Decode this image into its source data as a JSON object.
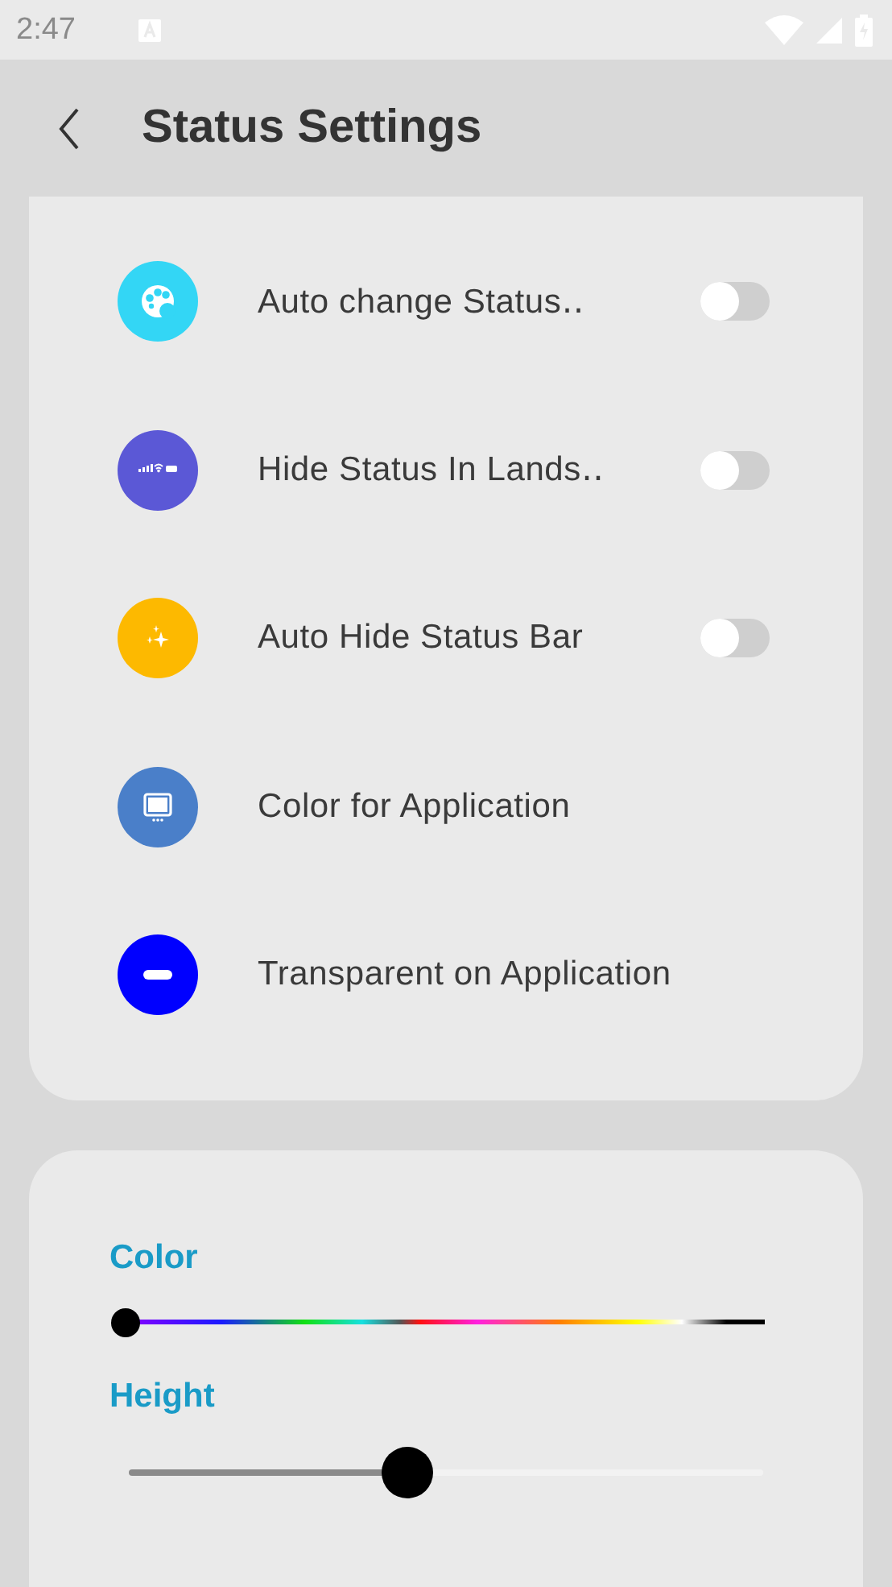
{
  "status_bar": {
    "time": "2:47"
  },
  "toolbar": {
    "title": "Status Settings"
  },
  "settings": [
    {
      "kind": "toggle",
      "label": "Auto change Status‥",
      "color": "#33d6f5",
      "on": false
    },
    {
      "kind": "toggle",
      "label": "Hide Status In Lands‥",
      "color": "#5b58d6",
      "on": false
    },
    {
      "kind": "toggle",
      "label": "Auto Hide Status Bar",
      "color": "#fdb900",
      "on": false
    },
    {
      "kind": "link",
      "label": "Color for Application",
      "color": "#4a7fc9"
    },
    {
      "kind": "link",
      "label": "Transparent on Application",
      "color": "#0000ff"
    }
  ],
  "sliders": [
    {
      "kind": "spectrum",
      "label": "Color",
      "level": 0
    },
    {
      "kind": "plain",
      "label": "Height",
      "level": 0.44
    }
  ]
}
